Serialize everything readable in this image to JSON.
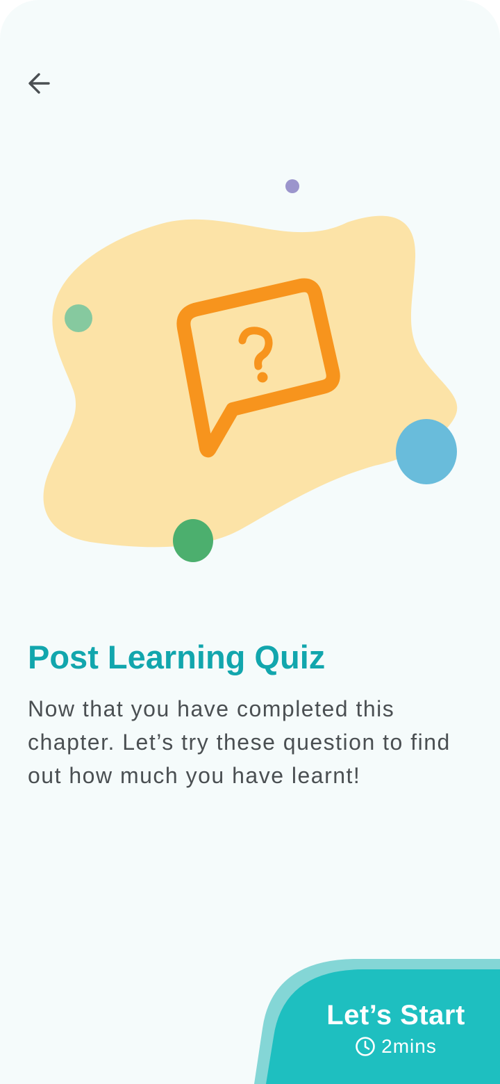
{
  "header": {
    "back_icon": "arrow-left-icon"
  },
  "illustration": {
    "icon": "question-speech-bubble-icon",
    "glyph": "?"
  },
  "content": {
    "title": "Post Learning Quiz",
    "description": "Now that you have completed this chapter. Let’s try these question to find out how much you have learnt!"
  },
  "start": {
    "label": "Let’s Start",
    "duration_icon": "clock-icon",
    "duration": "2mins"
  },
  "colors": {
    "accent": "#12a6ad",
    "button": "#1ebfc0",
    "button_light": "#84d6d6",
    "bubble": "#f7941d",
    "blob": "#fce3a7",
    "dot_purple": "#9b95cc",
    "dot_lightgreen": "#86c99f",
    "dot_green": "#4caf6e",
    "dot_blue": "#69bcdb"
  }
}
